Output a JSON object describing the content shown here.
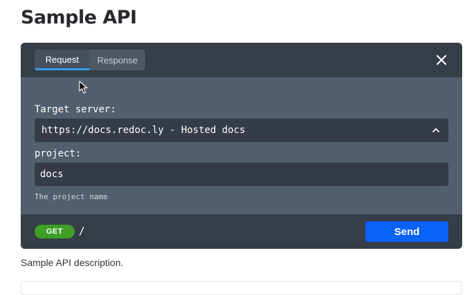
{
  "page": {
    "title": "Sample API",
    "description": "Sample API description."
  },
  "console": {
    "tabs": [
      {
        "label": "Request",
        "active": true
      },
      {
        "label": "Response",
        "active": false
      }
    ],
    "close_icon": "close-icon",
    "server": {
      "label": "Target server:",
      "selected": "https://docs.redoc.ly - Hosted docs"
    },
    "param": {
      "label": "project:",
      "value": "docs",
      "hint": "The project name"
    },
    "request": {
      "method": "GET",
      "path": "/",
      "send_label": "Send"
    }
  },
  "colors": {
    "console_bg": "#525f6c",
    "header_bg": "#353d47",
    "tab_indicator": "#33a0f0",
    "method_get": "#3f9e27",
    "send_button": "#0a63f6"
  }
}
